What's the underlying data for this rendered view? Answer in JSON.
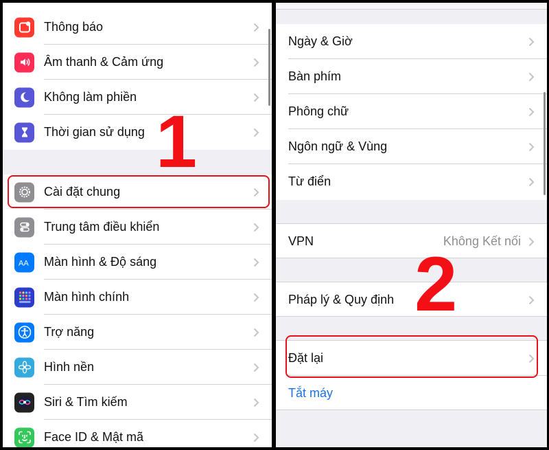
{
  "left": {
    "group1": [
      {
        "label": "Thông báo",
        "icon": "notifications-icon",
        "color": "#ff3b30"
      },
      {
        "label": "Âm thanh & Cảm ứng",
        "icon": "sounds-icon",
        "color": "#ff2d55"
      },
      {
        "label": "Không làm phiền",
        "icon": "moon-icon",
        "color": "#5856d6"
      },
      {
        "label": "Thời gian sử dụng",
        "icon": "hourglass-icon",
        "color": "#5856d6"
      }
    ],
    "group2": [
      {
        "label": "Cài đặt chung",
        "icon": "gear-icon",
        "color": "#8e8e93"
      },
      {
        "label": "Trung tâm điều khiển",
        "icon": "control-center-icon",
        "color": "#8e8e93"
      },
      {
        "label": "Màn hình & Độ sáng",
        "icon": "display-icon",
        "color": "#007aff"
      },
      {
        "label": "Màn hình chính",
        "icon": "home-screen-icon",
        "color": "#2c3ec9"
      },
      {
        "label": "Trợ năng",
        "icon": "accessibility-icon",
        "color": "#007aff"
      },
      {
        "label": "Hình nền",
        "icon": "wallpaper-icon",
        "color": "#35aadc"
      },
      {
        "label": "Siri & Tìm kiếm",
        "icon": "siri-icon",
        "color": "#222222"
      },
      {
        "label": "Face ID & Mật mã",
        "icon": "face-id-icon",
        "color": "#34c759"
      }
    ],
    "step_number": "1"
  },
  "right": {
    "group1": [
      {
        "label": "Ngày & Giờ"
      },
      {
        "label": "Bàn phím"
      },
      {
        "label": "Phông chữ"
      },
      {
        "label": "Ngôn ngữ & Vùng"
      },
      {
        "label": "Từ điển"
      }
    ],
    "vpn": {
      "label": "VPN",
      "value": "Không Kết nối"
    },
    "legal": {
      "label": "Pháp lý & Quy định"
    },
    "reset": {
      "label": "Đặt lại"
    },
    "shutdown": {
      "label": "Tắt máy"
    },
    "step_number": "2"
  },
  "colors": {
    "highlight": "#e8101a",
    "step_number": "#f20f16",
    "link_blue": "#1a73e8"
  }
}
